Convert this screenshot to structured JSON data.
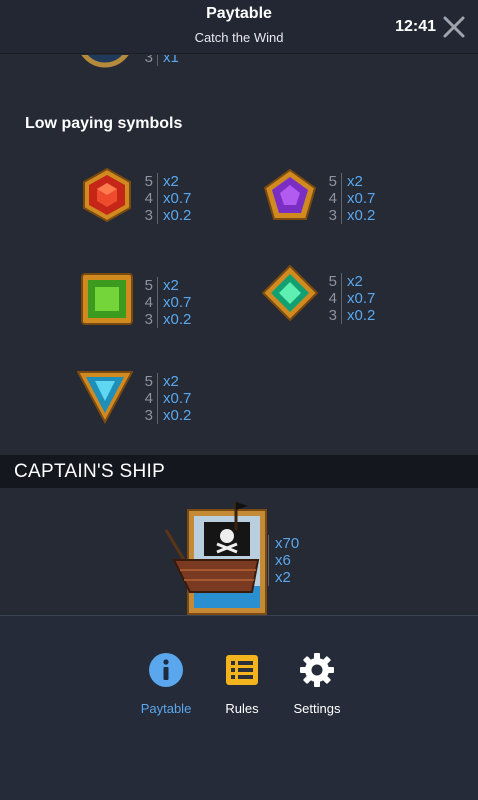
{
  "header": {
    "title": "Paytable",
    "subtitle": "Catch the Wind",
    "time": "12:41"
  },
  "top_partial_symbol": {
    "icon": "ship-wheel-symbol-icon",
    "count": "3",
    "payout": "x1"
  },
  "low_paying": {
    "title": "Low paying symbols",
    "symbols": [
      {
        "icon": "red-hexagon-gem-icon",
        "counts": [
          "5",
          "4",
          "3"
        ],
        "payouts": [
          "x2",
          "x0.7",
          "x0.2"
        ]
      },
      {
        "icon": "purple-pentagon-gem-icon",
        "counts": [
          "5",
          "4",
          "3"
        ],
        "payouts": [
          "x2",
          "x0.7",
          "x0.2"
        ]
      },
      {
        "icon": "green-square-gem-icon",
        "counts": [
          "5",
          "4",
          "3"
        ],
        "payouts": [
          "x2",
          "x0.7",
          "x0.2"
        ]
      },
      {
        "icon": "green-diamond-gem-icon",
        "counts": [
          "5",
          "4",
          "3"
        ],
        "payouts": [
          "x2",
          "x0.7",
          "x0.2"
        ]
      },
      {
        "icon": "blue-triangle-gem-icon",
        "counts": [
          "5",
          "4",
          "3"
        ],
        "payouts": [
          "x2",
          "x0.7",
          "x0.2"
        ]
      }
    ]
  },
  "captains_ship": {
    "title": "CAPTAIN'S SHIP",
    "icon": "pirate-ship-symbol-icon",
    "payouts": [
      "x70",
      "x6",
      "x2"
    ]
  },
  "footer": {
    "items": [
      {
        "label": "Paytable",
        "icon": "info-icon",
        "active": true
      },
      {
        "label": "Rules",
        "icon": "list-icon",
        "active": false
      },
      {
        "label": "Settings",
        "icon": "gear-icon",
        "active": false
      }
    ]
  },
  "colors": {
    "background": "#252a35",
    "accent": "#5aa7ee",
    "muted": "#8d93a0",
    "section_bar": "#14171e"
  }
}
